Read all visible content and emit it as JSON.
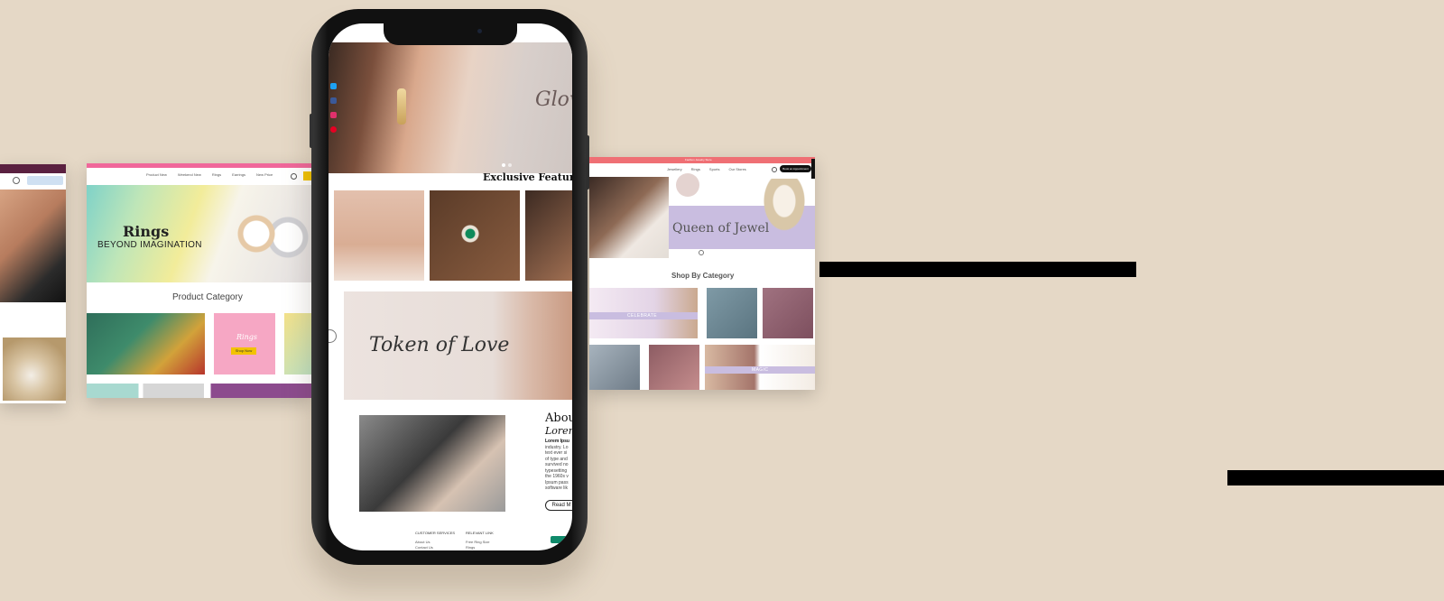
{
  "left_card": {
    "menu": [
      "Product New",
      "Weekend New",
      "Rings",
      "Earrings",
      "New Price"
    ],
    "banner_title": "Rings",
    "banner_subtitle": "BEYOND IMAGINATION",
    "section_title": "Product Category",
    "tile_label": "Rings",
    "tile_button": "Shop Now"
  },
  "phone": {
    "hero_text": "Glow",
    "social_icons": [
      "twitter-icon",
      "facebook-icon",
      "instagram-icon",
      "pinterest-icon"
    ],
    "featured_title": "Exclusive Featured",
    "promo_text": "Token of Love",
    "about_title": "Abou",
    "about_subtitle": "Lorem",
    "about_lines": [
      "Lorem Ipsu",
      "industry. Lo",
      "text ever si",
      "of type and",
      "survived no",
      "typesetting",
      "the 1960s v",
      "Ipsum pass",
      "software lik"
    ],
    "read_more": "Read M",
    "footer_col1_title": "CUSTOMER SERVICES",
    "footer_col1_items": [
      "About Us",
      "Contact Us"
    ],
    "footer_col2_title": "RELEVANT LINK",
    "footer_col2_items": [
      "Free Ring Size",
      "Rings"
    ]
  },
  "right_card": {
    "topbar_text": "Fashion Jewelry Store",
    "nav": [
      "Jewellery",
      "Rings",
      "Sports",
      "Our Stores"
    ],
    "appointment_button": "Book an Appointment",
    "hero_text": "Queen of Jewel",
    "section_title": "Shop By Category",
    "tag_celebrate": "CELEBRATE",
    "tag_magic": "MAGIC"
  },
  "colors": {
    "background": "#e5d8c6",
    "pink_bar": "#f0679a",
    "coral_bar": "#ef6f74",
    "plum_bar": "#5a2040",
    "lavender": "#c9bde0"
  }
}
